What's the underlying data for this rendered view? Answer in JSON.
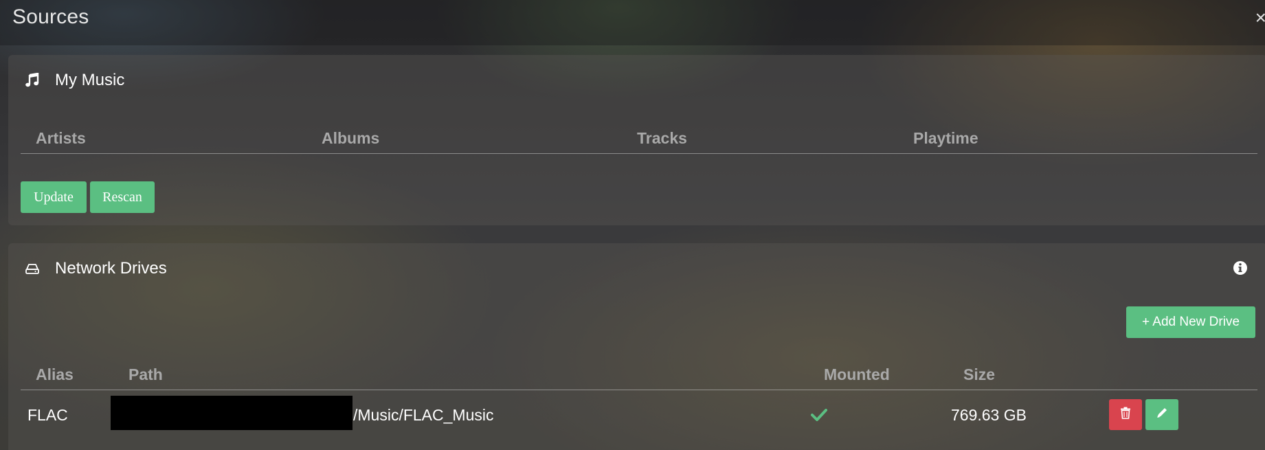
{
  "page": {
    "title": "Sources",
    "close_glyph": "×"
  },
  "my_music": {
    "title": "My Music",
    "icon": "music-note-icon",
    "columns": [
      "Artists",
      "Albums",
      "Tracks",
      "Playtime"
    ],
    "buttons": {
      "update": "Update",
      "rescan": "Rescan"
    }
  },
  "network_drives": {
    "title": "Network Drives",
    "icon": "hard-drive-icon",
    "info_icon": "info-circle-icon",
    "add_button": "+ Add New Drive",
    "columns": {
      "alias": "Alias",
      "path": "Path",
      "mounted": "Mounted",
      "size": "Size"
    },
    "rows": [
      {
        "alias": "FLAC",
        "path_visible": "/Music/FLAC_Music",
        "mounted": true,
        "size": "769.63 GB"
      }
    ]
  },
  "colors": {
    "accent_green": "#5bbf82",
    "danger_red": "#d9444e",
    "muted_label": "#a9a9a9"
  }
}
